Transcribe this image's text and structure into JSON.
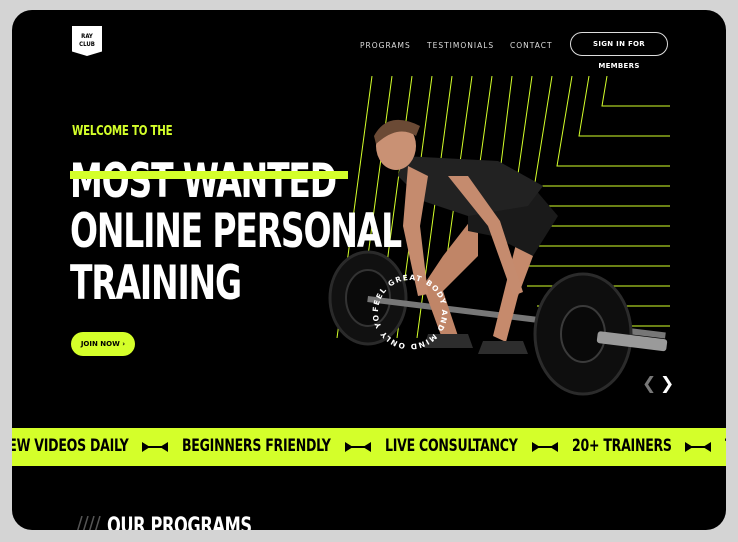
{
  "brand": {
    "logo_line1": "RAY",
    "logo_line2": "CLUB"
  },
  "nav": {
    "programs": "PROGRAMS",
    "testimonials": "TESTIMONIALS",
    "contact": "CONTACT",
    "signin": "SIGN IN FOR MEMBERS"
  },
  "hero": {
    "welcome": "WELCOME TO THE",
    "line1": "MOST WANTED",
    "line2": "ONLINE PERSONAL",
    "line3": "TRAINING",
    "join_label": "JOIN NOW",
    "join_arrow": "›",
    "badge_text": "FEEL GREAT BODY AND MIND ONLY YOU",
    "prev_arrow": "❮",
    "next_arrow": "❯"
  },
  "ticker": [
    "NEW VIDEOS DAILY",
    "BEGINNERS FRIENDLY",
    "LIVE CONSULTANCY",
    "20+ TRAINERS",
    "TRAIN ANYWHERE"
  ],
  "section": {
    "programs_title": "OUR PROGRAMS"
  },
  "colors": {
    "accent": "#d4ff2a",
    "background": "#000000",
    "text": "#ffffff"
  }
}
